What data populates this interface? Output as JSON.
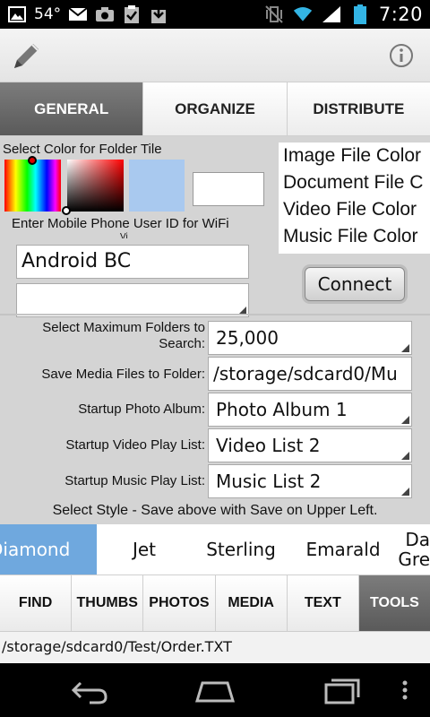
{
  "status_bar": {
    "temperature": "54°",
    "time": "7:20"
  },
  "action_bar": {
    "icons": [
      "pencil-icon",
      "info-icon"
    ]
  },
  "top_tabs": [
    {
      "label": "GENERAL",
      "active": true
    },
    {
      "label": "ORGANIZE",
      "active": false
    },
    {
      "label": "DISTRIBUTE",
      "active": false
    }
  ],
  "general": {
    "folder_tile_label": "Select Color for Folder Tile",
    "folder_tile_preview_color": "#a9c9ef",
    "file_colors": [
      "Image File Color",
      "Document File C",
      "Video File Color",
      "Music File Color"
    ],
    "wifi_label_line1": "Enter Mobile Phone User ID for WiFi",
    "wifi_label_line2": "Vi",
    "user_id_value": "Android BC",
    "second_field_value": "",
    "connect_label": "Connect",
    "max_folders_label_line1": "Select Maximum Folders to",
    "max_folders_label_line2": "Search:",
    "max_folders_value": "25,000",
    "save_media_label": "Save Media Files to Folder:",
    "save_media_value": "/storage/sdcard0/Mu",
    "photo_album_label": "Startup Photo Album:",
    "photo_album_value": "Photo Album 1",
    "video_list_label": "Startup Video Play List:",
    "video_list_value": "Video List 2",
    "music_list_label": "Startup Music Play List:",
    "music_list_value": "Music List 2",
    "style_hint": "Select Style - Save above with Save on Upper Left."
  },
  "styles": [
    {
      "label": "Diamond",
      "active": true
    },
    {
      "label": "Jet",
      "active": false
    },
    {
      "label": "Sterling",
      "active": false
    },
    {
      "label": "Emarald",
      "active": false
    },
    {
      "label": "Da",
      "label2": "Gre",
      "active": false
    }
  ],
  "bottom_tabs": [
    {
      "label": "FIND",
      "active": false
    },
    {
      "label": "THUMBS",
      "active": false
    },
    {
      "label": "PHOTOS",
      "active": false
    },
    {
      "label": "MEDIA",
      "active": false
    },
    {
      "label": "TEXT",
      "active": false
    },
    {
      "label": "TOOLS",
      "active": true
    }
  ],
  "path": "/storage/sdcard0/Test/Order.TXT",
  "colors": {
    "accent_active_tab": "#666666",
    "style_selected": "#6fa8de",
    "panel_bg": "#d4d4d4"
  }
}
